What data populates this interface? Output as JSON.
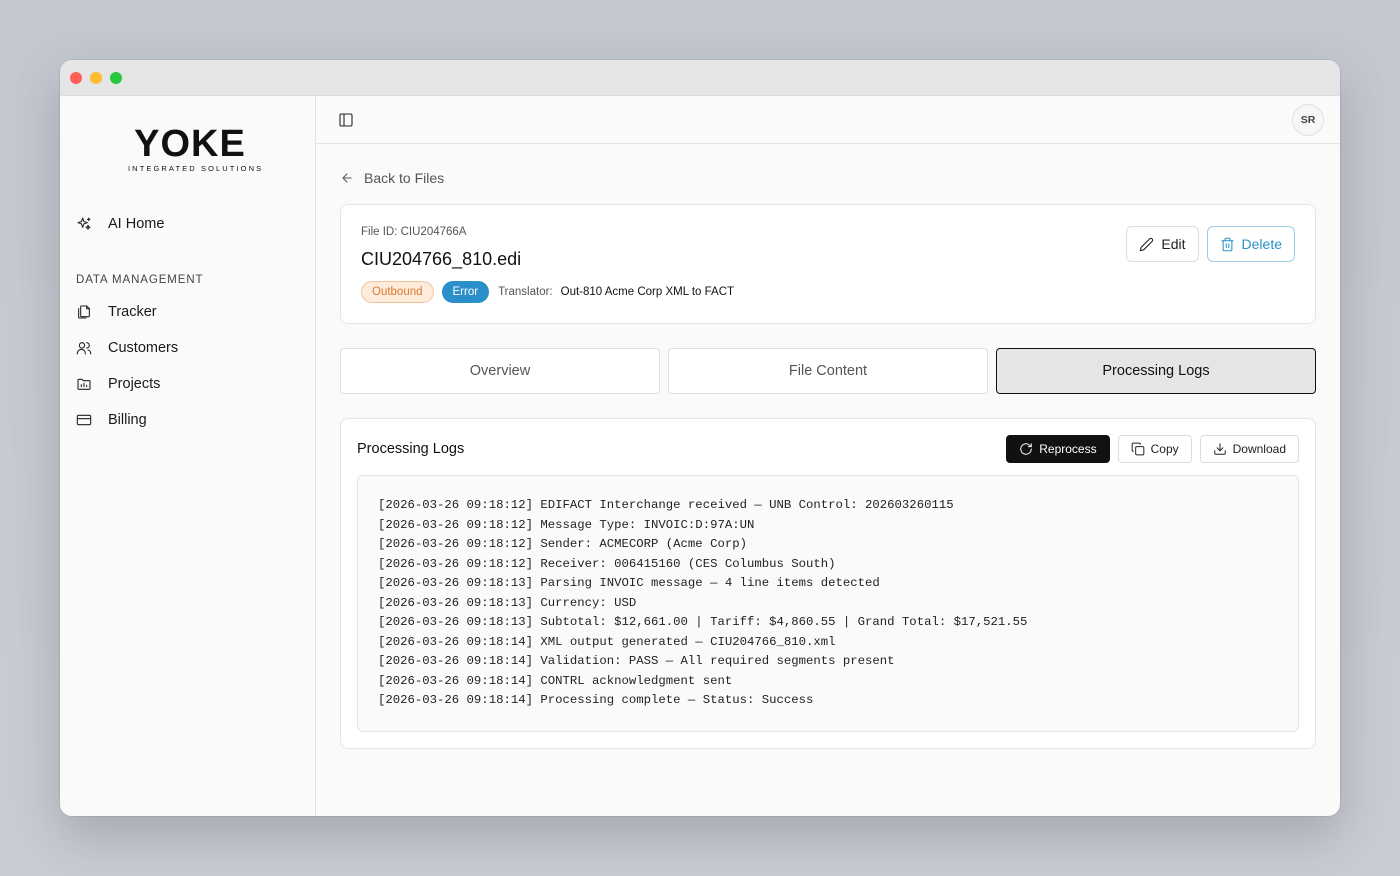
{
  "window": {
    "controls": [
      "close",
      "minimize",
      "maximize"
    ]
  },
  "brand": {
    "name": "YOKE",
    "tagline": "INTEGRATED SOLUTIONS"
  },
  "sidebar": {
    "home": {
      "label": "AI Home",
      "icon": "sparkle-icon"
    },
    "section_label": "DATA MANAGEMENT",
    "items": [
      {
        "label": "Tracker",
        "icon": "files-icon"
      },
      {
        "label": "Customers",
        "icon": "users-icon"
      },
      {
        "label": "Projects",
        "icon": "folder-chart-icon"
      },
      {
        "label": "Billing",
        "icon": "credit-card-icon"
      }
    ]
  },
  "topbar": {
    "toggle_icon": "sidebar-toggle-icon",
    "avatar_initials": "SR"
  },
  "back_link": {
    "label": "Back to Files",
    "icon": "arrow-left-icon"
  },
  "file": {
    "id_text": "File ID: CIU204766A",
    "name": "CIU204766_810.edi",
    "direction": "Outbound",
    "status": "Error",
    "translator_label": "Translator:",
    "translator": "Out-810 Acme Corp XML to FACT",
    "edit_label": "Edit",
    "delete_label": "Delete"
  },
  "tabs": [
    {
      "label": "Overview",
      "active": false
    },
    {
      "label": "File Content",
      "active": false
    },
    {
      "label": "Processing Logs",
      "active": true
    }
  ],
  "logs": {
    "title": "Processing Logs",
    "reprocess_label": "Reprocess",
    "copy_label": "Copy",
    "download_label": "Download",
    "lines": [
      "[2026-03-26 09:18:12] EDIFACT Interchange received — UNB Control: 202603260115",
      "[2026-03-26 09:18:12] Message Type: INVOIC:D:97A:UN",
      "[2026-03-26 09:18:12] Sender: ACMECORP (Acme Corp)",
      "[2026-03-26 09:18:12] Receiver: 006415160 (CES Columbus South)",
      "[2026-03-26 09:18:13] Parsing INVOIC message — 4 line items detected",
      "[2026-03-26 09:18:13] Currency: USD",
      "[2026-03-26 09:18:13] Subtotal: $12,661.00 | Tariff: $4,860.55 | Grand Total: $17,521.55",
      "[2026-03-26 09:18:14] XML output generated — CIU204766_810.xml",
      "[2026-03-26 09:18:14] Validation: PASS — All required segments present",
      "[2026-03-26 09:18:14] CONTRL acknowledgment sent",
      "[2026-03-26 09:18:14] Processing complete — Status: Success"
    ]
  },
  "fab": {
    "icon": "phone-icon"
  },
  "colors": {
    "accent_blue": "#2b8fc9",
    "outbound_orange": "#e07b2d",
    "primary_dark": "#111111"
  }
}
